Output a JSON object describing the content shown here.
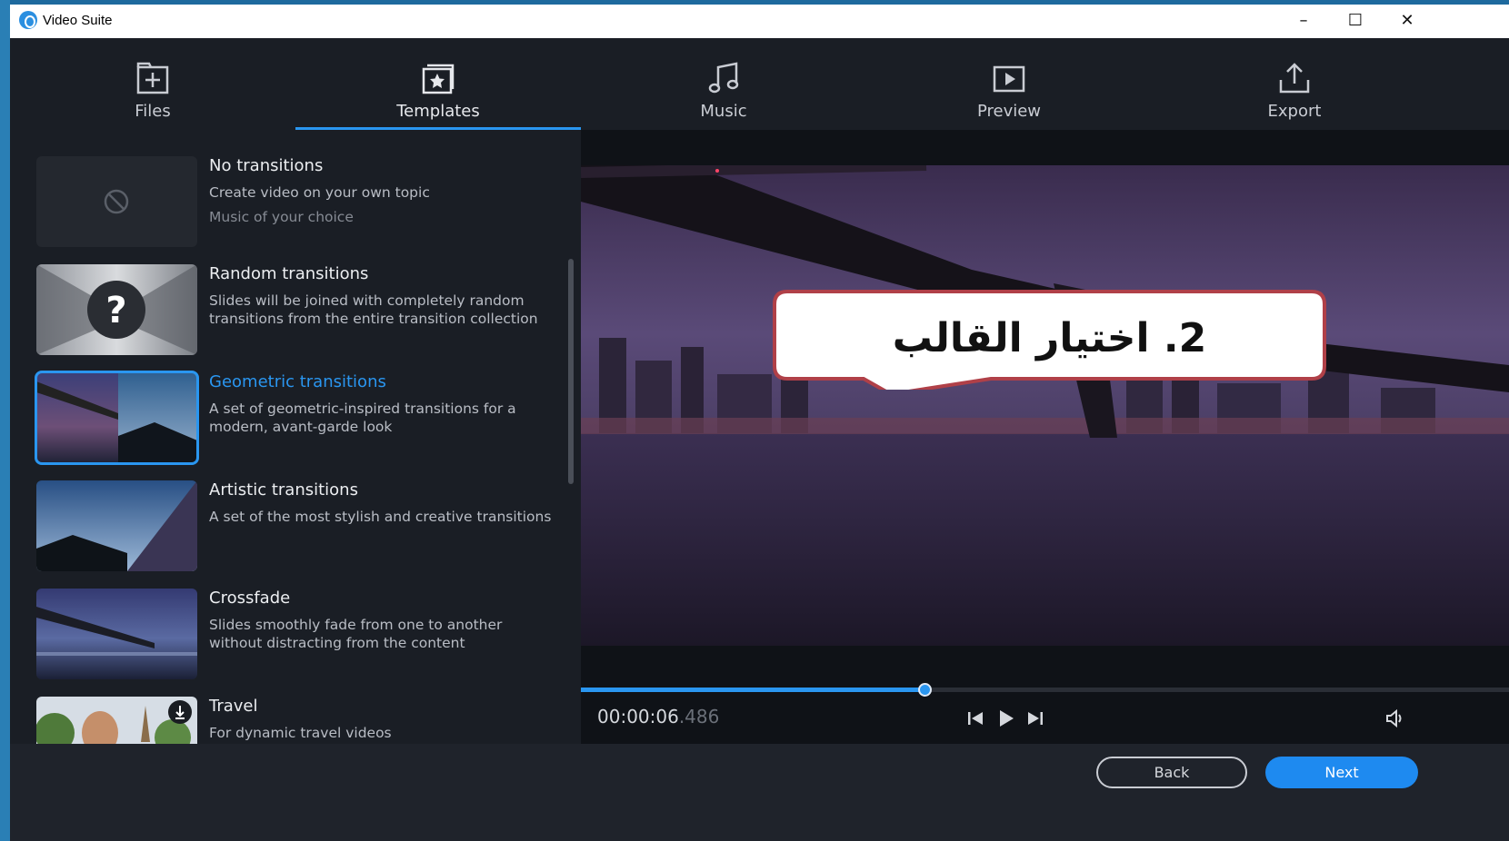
{
  "window": {
    "title": "Video Suite"
  },
  "tabs": [
    {
      "label": "Files",
      "icon": "add-file-icon"
    },
    {
      "label": "Templates",
      "icon": "template-star-icon",
      "active": true
    },
    {
      "label": "Music",
      "icon": "music-note-icon"
    },
    {
      "label": "Preview",
      "icon": "play-preview-icon"
    },
    {
      "label": "Export",
      "icon": "export-upload-icon"
    }
  ],
  "templates": [
    {
      "name": "No transitions",
      "desc": "Create video on your own topic",
      "desc2": "Music of your choice"
    },
    {
      "name": "Random transitions",
      "desc": "Slides will be joined with completely random transitions from the entire transition collection"
    },
    {
      "name": "Geometric transitions",
      "desc": "A set of geometric-inspired transitions for a modern, avant-garde look",
      "selected": true
    },
    {
      "name": "Artistic transitions",
      "desc": "A set of the most stylish and creative transitions"
    },
    {
      "name": "Crossfade",
      "desc": "Slides smoothly fade from one to another without distracting from the content"
    },
    {
      "name": "Travel",
      "desc": "For dynamic travel videos"
    }
  ],
  "player": {
    "time_main": "00:00:06",
    "time_ms": ".486",
    "progress": 0.37
  },
  "footer": {
    "back_label": "Back",
    "next_label": "Next"
  },
  "annotation": {
    "text": "2. اختيار القالب"
  },
  "colors": {
    "accent": "#2a96f0",
    "background": "#1a1e25",
    "next_button": "#1e8af0"
  }
}
